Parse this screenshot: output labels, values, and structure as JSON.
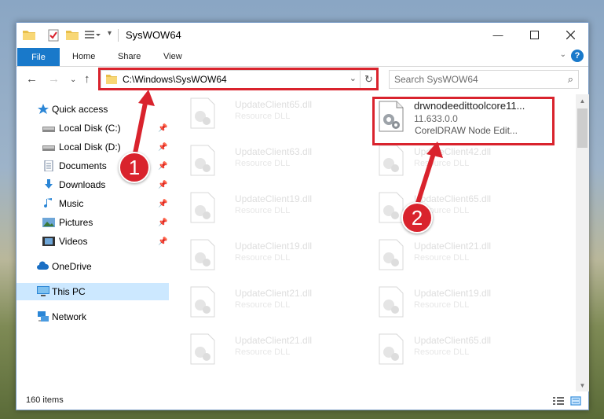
{
  "window": {
    "title": "SysWOW64"
  },
  "ribbon": {
    "tabs": [
      {
        "label": "File"
      },
      {
        "label": "Home"
      },
      {
        "label": "Share"
      },
      {
        "label": "View"
      }
    ],
    "help": "?"
  },
  "address": {
    "path": "C:\\Windows\\SysWOW64"
  },
  "search": {
    "placeholder": "Search SysWOW64"
  },
  "sidebar": {
    "items": [
      {
        "label": "Quick access",
        "icon": "star-icon"
      },
      {
        "label": "Local Disk (C:)",
        "icon": "drive-icon",
        "pinned": true
      },
      {
        "label": "Local Disk (D:)",
        "icon": "drive-icon",
        "pinned": true
      },
      {
        "label": "Documents",
        "icon": "documents-icon",
        "pinned": true
      },
      {
        "label": "Downloads",
        "icon": "download-icon",
        "pinned": true
      },
      {
        "label": "Music",
        "icon": "music-icon",
        "pinned": true
      },
      {
        "label": "Pictures",
        "icon": "pictures-icon",
        "pinned": true
      },
      {
        "label": "Videos",
        "icon": "videos-icon",
        "pinned": true
      },
      {
        "label": "OneDrive",
        "icon": "cloud-icon"
      },
      {
        "label": "This PC",
        "icon": "computer-icon",
        "selected": true
      },
      {
        "label": "Network",
        "icon": "network-icon"
      }
    ]
  },
  "files": {
    "left": [
      {
        "name": "UpdateClient65.dll",
        "type": "Resource DLL"
      },
      {
        "name": "UpdateClient63.dll",
        "type": "Resource DLL"
      },
      {
        "name": "UpdateClient19.dll",
        "type": "Resource DLL"
      },
      {
        "name": "UpdateClient19.dll",
        "type": "Resource DLL"
      },
      {
        "name": "UpdateClient21.dll",
        "type": "Resource DLL"
      },
      {
        "name": "UpdateClient21.dll",
        "type": "Resource DLL"
      }
    ],
    "right": [
      {
        "name": "drwnodeedittoolcore11...",
        "version": "11.633.0.0",
        "type": "CorelDRAW Node Edit..."
      },
      {
        "name": "UpdateClient42.dll",
        "type": "Resource DLL"
      },
      {
        "name": "UpdateClient65.dll",
        "type": "Resource DLL"
      },
      {
        "name": "UpdateClient21.dll",
        "type": "Resource DLL"
      },
      {
        "name": "UpdateClient19.dll",
        "type": "Resource DLL"
      },
      {
        "name": "UpdateClient65.dll",
        "type": "Resource DLL"
      }
    ]
  },
  "status": {
    "count": "160 items"
  },
  "annotations": {
    "badge1": "1",
    "badge2": "2"
  },
  "colors": {
    "accent": "#1979ca",
    "highlight": "#d9232d",
    "selected": "#cce8ff"
  }
}
